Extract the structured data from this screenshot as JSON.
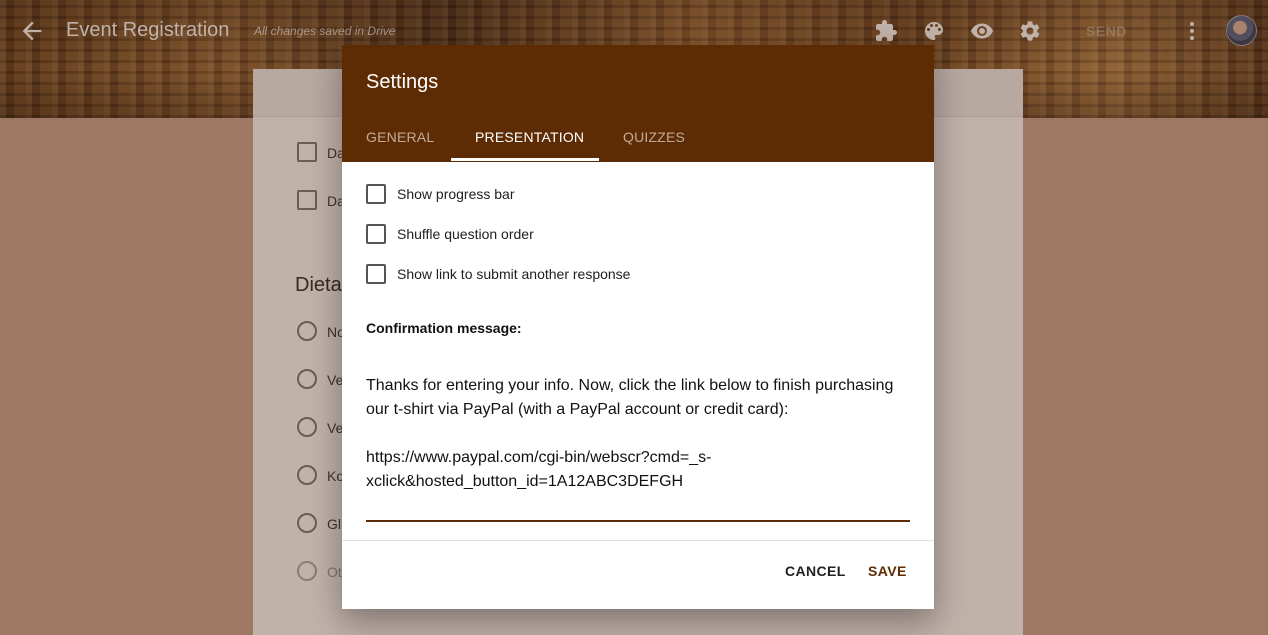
{
  "topbar": {
    "title": "Event Registration",
    "save_status": "All changes saved in Drive",
    "send_label": "SEND"
  },
  "background_form": {
    "checkbox_options": [
      "Da",
      "Da"
    ],
    "section_heading": "Dietar",
    "radio_options": [
      "No",
      "Ve",
      "Ve",
      "Ko",
      "Glu",
      "Oth"
    ]
  },
  "dialog": {
    "title": "Settings",
    "tabs": [
      {
        "label": "GENERAL",
        "active": false
      },
      {
        "label": "PRESENTATION",
        "active": true
      },
      {
        "label": "QUIZZES",
        "active": false
      }
    ],
    "options": [
      {
        "label": "Show progress bar",
        "checked": false
      },
      {
        "label": "Shuffle question order",
        "checked": false
      },
      {
        "label": "Show link to submit another response",
        "checked": false
      }
    ],
    "confirmation_label": "Confirmation message:",
    "confirmation_text": "Thanks for entering your info. Now, click the link below to finish purchasing our t-shirt via PayPal (with a PayPal account or credit card):\n\nhttps://www.paypal.com/cgi-bin/webscr?cmd=_s-xclick&hosted_button_id=1A12ABC3DEFGH",
    "cancel_label": "CANCEL",
    "save_label": "SAVE"
  },
  "colors": {
    "theme": "#5e2c04",
    "backdrop": "#c9a390"
  }
}
